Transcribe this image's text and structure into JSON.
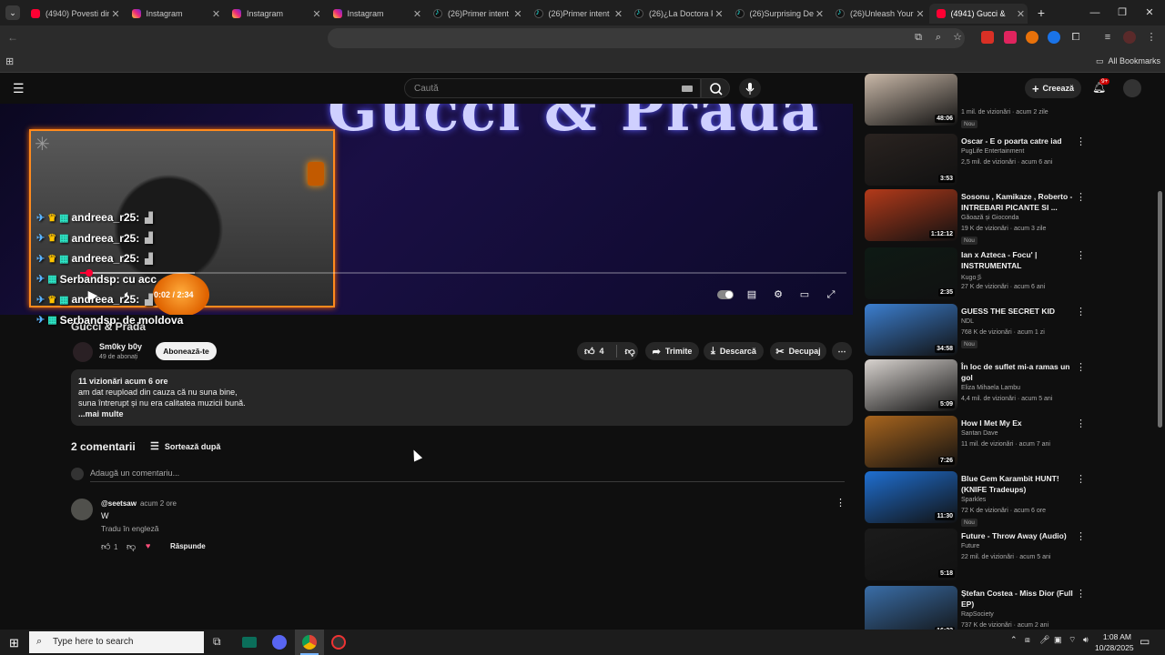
{
  "browser": {
    "tabs": [
      {
        "title": "(4940) Povesti din",
        "icon": "youtube-icon",
        "active": false
      },
      {
        "title": "Instagram",
        "icon": "instagram-icon",
        "active": false
      },
      {
        "title": "Instagram",
        "icon": "instagram-icon",
        "active": false
      },
      {
        "title": "Instagram",
        "icon": "instagram-icon",
        "active": false
      },
      {
        "title": "(26)Primer intent",
        "icon": "tiktok-icon",
        "active": false
      },
      {
        "title": "(26)Primer intent",
        "icon": "tiktok-icon",
        "active": false
      },
      {
        "title": "(26)¿La Doctora P",
        "icon": "tiktok-icon",
        "active": false
      },
      {
        "title": "(26)Surprising De",
        "icon": "tiktok-icon",
        "active": false
      },
      {
        "title": "(26)Unleash Your",
        "icon": "tiktok-icon",
        "active": false
      },
      {
        "title": "(4941) Gucci &",
        "icon": "youtube-icon",
        "active": true
      }
    ],
    "new_tab": "+",
    "bookmarks_label": "All Bookmarks"
  },
  "youtube": {
    "search_placeholder": "Caută",
    "create_label": "Creează",
    "notif_count": "9+"
  },
  "player": {
    "overlay_title": "Gucci & Prada",
    "time": "0:02 / 2:34",
    "progress_fraction": 0.013,
    "buffer_fraction": 0.15
  },
  "chat_overlay": [
    {
      "user": "andreea_r25:",
      "msg": ""
    },
    {
      "user": "andreea_r25:",
      "msg": ""
    },
    {
      "user": "andreea_r25:",
      "msg": ""
    },
    {
      "user": "Serbandsp:",
      "msg": "cu acc"
    },
    {
      "user": "andreea_r25:",
      "msg": ""
    },
    {
      "user": "Serbandsp:",
      "msg": "de moldova"
    }
  ],
  "video": {
    "title": "Gucci & Prada",
    "channel": "Sm0ky b0y",
    "subscribers": "49 de abonați",
    "subscribe_label": "Abonează-te",
    "likes": "4",
    "share_label": "Trimite",
    "download_label": "Descarcă",
    "clip_label": "Decupaj",
    "description": {
      "stats": "11 vizionări  acum 6 ore",
      "line1": "am dat reupload din cauza că nu suna bine,",
      "line2": "suna întrerupt și nu era calitatea muzicii bună.",
      "more": "...mai multe"
    }
  },
  "comments": {
    "count_label": "2 comentarii",
    "sort_label": "Sortează după",
    "add_placeholder": "Adaugă un comentariu...",
    "items": [
      {
        "author": "@seetsaw",
        "time": "acum 2 ore",
        "text": "W",
        "translate": "Tradu în engleză",
        "likes": "1",
        "reply_label": "Răspunde"
      }
    ]
  },
  "recommendations": [
    {
      "title": "",
      "channel": "",
      "meta": "1 mil. de vizionări · acum 2 zile",
      "duration": "48:06",
      "badge": "Nou",
      "thumb_color": "#c9b8a8"
    },
    {
      "title": "Oscar - E o poarta catre iad",
      "channel": "PugLife Entertainment",
      "meta": "2,5 mil. de vizionări · acum 6 ani",
      "duration": "3:53",
      "badge": "",
      "thumb_color": "#2a2320"
    },
    {
      "title": "Sosonu , Kamikaze , Roberto - INTREBARI PICANTE SI ...",
      "channel": "Găoază și Gioconda",
      "meta": "19 K de vizionări · acum 3 zile",
      "duration": "1:12:12",
      "badge": "Nou",
      "thumb_color": "#b33a1a"
    },
    {
      "title": "Ian x Azteca - Focu' | INSTRUMENTAL",
      "channel": "Kugo彡",
      "meta": "27 K de vizionări · acum 6 ani",
      "duration": "2:35",
      "badge": "",
      "thumb_color": "#0e1a14"
    },
    {
      "title": "GUESS THE SECRET KID",
      "channel": "NDL",
      "meta": "768 K de vizionări · acum 1 zi",
      "duration": "34:58",
      "badge": "Nou",
      "thumb_color": "#3c7fd0"
    },
    {
      "title": "În loc de suflet  mi-a ramas un gol",
      "channel": "Eliza Mihaela Lambu",
      "meta": "4,4 mil. de vizionări · acum 5 ani",
      "duration": "5:09",
      "badge": "",
      "thumb_color": "#d8d3cf"
    },
    {
      "title": "How I Met My Ex",
      "channel": "Santan Dave",
      "meta": "11 mil. de vizionări · acum 7 ani",
      "duration": "7:26",
      "badge": "",
      "thumb_color": "#a8651e"
    },
    {
      "title": "Blue Gem Karambit HUNT! (KNIFE Tradeups)",
      "channel": "Sparkles",
      "meta": "72 K de vizionări · acum 6 ore",
      "duration": "11:30",
      "badge": "Nou",
      "thumb_color": "#1f6fd1"
    },
    {
      "title": "Future - Throw Away (Audio)",
      "channel": "Future",
      "meta": "22 mil. de vizionări · acum 5 ani",
      "duration": "5:18",
      "badge": "",
      "thumb_color": "#1b1b1b"
    },
    {
      "title": "Ștefan Costea - Miss Dior (Full EP)",
      "channel": "RapSociety",
      "meta": "737 K de vizionări · acum 2 ani",
      "duration": "16:22",
      "badge": "",
      "thumb_color": "#3a6ea8"
    }
  ],
  "taskbar": {
    "search_placeholder": "Type here to search",
    "time": "1:08 AM",
    "date": "10/28/2025"
  }
}
